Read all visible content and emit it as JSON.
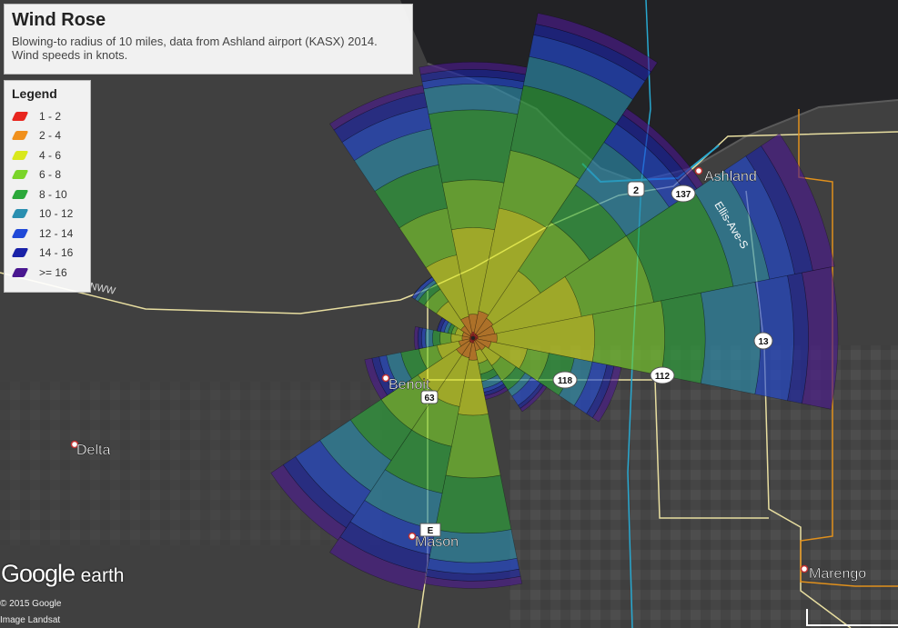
{
  "title": "Wind Rose",
  "subtitle_line1": "Blowing-to radius of 10 miles, data from Ashland airport (KASX) 2014.",
  "subtitle_line2": "Wind speeds in knots.",
  "legend": {
    "title": "Legend",
    "items": [
      {
        "label": "1 - 2",
        "color": "#e8261f"
      },
      {
        "label": "2 - 4",
        "color": "#f0901c"
      },
      {
        "label": "4 - 6",
        "color": "#d9e81c"
      },
      {
        "label": "6 - 8",
        "color": "#7ad42a"
      },
      {
        "label": "8 - 10",
        "color": "#2ca83a"
      },
      {
        "label": "10 - 12",
        "color": "#2a8fb0"
      },
      {
        "label": "12 - 14",
        "color": "#2049d8"
      },
      {
        "label": "14 - 16",
        "color": "#1a22a8"
      },
      {
        "label": ">= 16",
        "color": "#4a1890"
      }
    ]
  },
  "places": {
    "ashland": "Ashland",
    "benoit": "Benoit",
    "delta": "Delta",
    "mason": "Mason",
    "marengo": "Marengo",
    "ellis": "Ellis-Ave-S"
  },
  "shields": {
    "s2": "2",
    "s137": "137",
    "s13": "13",
    "s118": "118",
    "s112": "112",
    "s63": "63",
    "sE": "E"
  },
  "nww_label": "NWW",
  "logo": {
    "google": "Google",
    "earth": "earth"
  },
  "credits": {
    "line1": "© 2015 Google",
    "line2": "Image Landsat"
  },
  "chart_data": {
    "type": "wind-rose",
    "bins": [
      "1 - 2",
      "2 - 4",
      "4 - 6",
      "6 - 8",
      "8 - 10",
      "10 - 12",
      "12 - 14",
      "14 - 16",
      ">= 16"
    ],
    "directions": [
      {
        "bearing": 0,
        "cumulative": [
          0.017,
          0.065,
          0.3,
          0.43,
          0.62,
          0.69,
          0.71,
          0.73,
          0.75
        ]
      },
      {
        "bearing": 22.5,
        "cumulative": [
          0.013,
          0.075,
          0.36,
          0.52,
          0.7,
          0.78,
          0.84,
          0.87,
          0.9
        ]
      },
      {
        "bearing": 45,
        "cumulative": [
          0.013,
          0.065,
          0.22,
          0.38,
          0.5,
          0.64,
          0.7,
          0.73,
          0.75
        ]
      },
      {
        "bearing": 67.5,
        "cumulative": [
          0.013,
          0.06,
          0.3,
          0.5,
          0.72,
          0.82,
          0.89,
          0.94,
          1.0
        ]
      },
      {
        "bearing": 90,
        "cumulative": [
          0.013,
          0.065,
          0.33,
          0.52,
          0.63,
          0.78,
          0.87,
          0.91,
          0.99
        ]
      },
      {
        "bearing": 112.5,
        "cumulative": [
          0.01,
          0.05,
          0.15,
          0.21,
          0.28,
          0.33,
          0.37,
          0.39,
          0.41
        ]
      },
      {
        "bearing": 135,
        "cumulative": [
          0.008,
          0.04,
          0.09,
          0.14,
          0.17,
          0.19,
          0.22,
          0.23,
          0.24
        ]
      },
      {
        "bearing": 157.5,
        "cumulative": [
          0.008,
          0.035,
          0.07,
          0.1,
          0.12,
          0.14,
          0.15,
          0.16,
          0.17
        ]
      },
      {
        "bearing": 180,
        "cumulative": [
          0.013,
          0.06,
          0.21,
          0.38,
          0.53,
          0.61,
          0.64,
          0.66,
          0.68
        ]
      },
      {
        "bearing": 202.5,
        "cumulative": [
          0.013,
          0.055,
          0.19,
          0.3,
          0.43,
          0.53,
          0.6,
          0.65,
          0.7
        ]
      },
      {
        "bearing": 225,
        "cumulative": [
          0.013,
          0.055,
          0.18,
          0.3,
          0.4,
          0.5,
          0.58,
          0.62,
          0.66
        ]
      },
      {
        "bearing": 247.5,
        "cumulative": [
          0.01,
          0.04,
          0.1,
          0.15,
          0.2,
          0.24,
          0.26,
          0.28,
          0.3
        ]
      },
      {
        "bearing": 270,
        "cumulative": [
          0.008,
          0.03,
          0.06,
          0.09,
          0.11,
          0.13,
          0.14,
          0.15,
          0.16
        ]
      },
      {
        "bearing": 292.5,
        "cumulative": [
          0.008,
          0.03,
          0.05,
          0.06,
          0.07,
          0.08,
          0.09,
          0.1,
          0.1
        ]
      },
      {
        "bearing": 315,
        "cumulative": [
          0.01,
          0.04,
          0.12,
          0.16,
          0.18,
          0.19,
          0.2,
          0.2,
          0.2
        ]
      },
      {
        "bearing": 337.5,
        "cumulative": [
          0.013,
          0.06,
          0.23,
          0.36,
          0.48,
          0.58,
          0.64,
          0.68,
          0.7
        ]
      }
    ]
  }
}
